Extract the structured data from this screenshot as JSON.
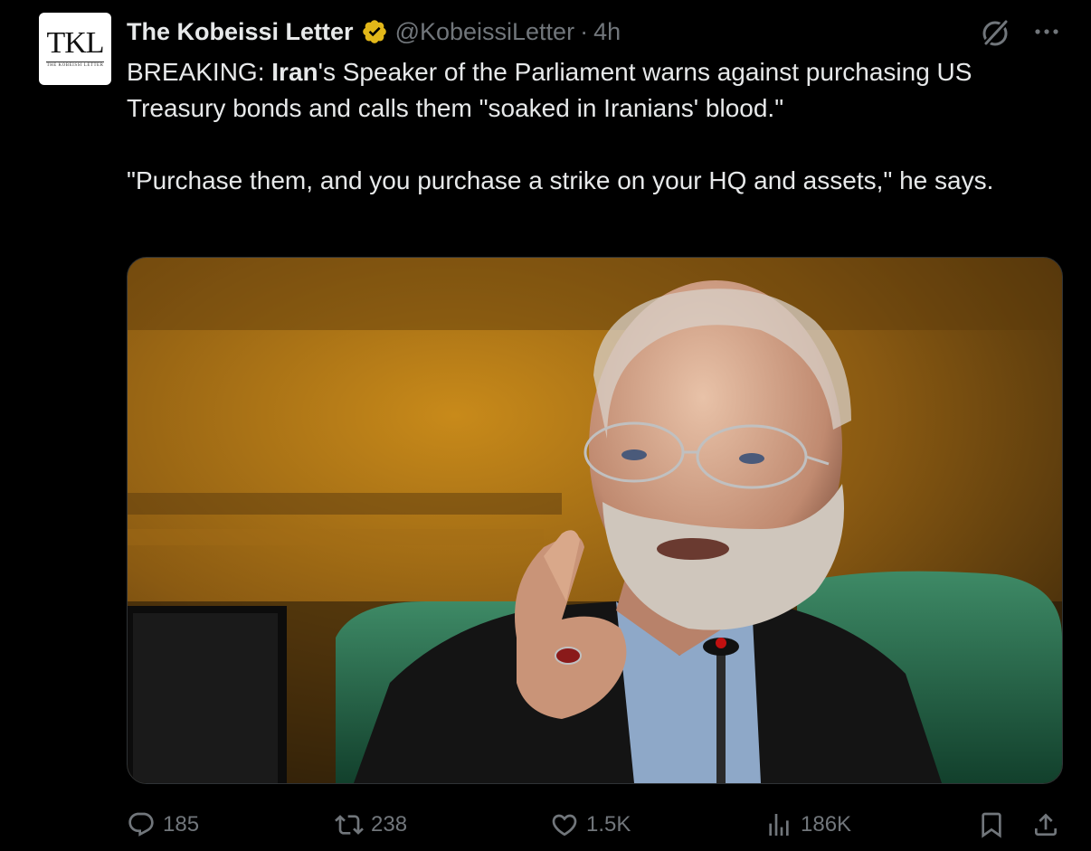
{
  "author": {
    "avatar_text": "TKL",
    "avatar_subtext": "THE KOBEISSI LETTER",
    "display_name": "The Kobeissi Letter",
    "handle": "@KobeissiLetter",
    "separator": "·",
    "time": "4h",
    "verified_icon": "verified-badge-icon",
    "verified_color": "#e2b719"
  },
  "header_icons": [
    "grok-icon",
    "more-icon"
  ],
  "tweet": {
    "p1_prefix": "BREAKING: ",
    "p1_bold": "Iran",
    "p1_rest": "'s Speaker of the Parliament warns against purchasing US Treasury bonds and calls them \"soaked in Iranians' blood.\"",
    "p2": "\"Purchase them, and you purchase a strike on your HQ and assets,\" he says."
  },
  "media": {
    "kind": "photo",
    "subject_icon": "photo-speaker-icon"
  },
  "actions": {
    "replies": "185",
    "reposts": "238",
    "likes": "1.5K",
    "views": "186K"
  },
  "colors": {
    "background": "#000000",
    "text": "#e7e9ea",
    "muted": "#71767b",
    "border": "#2f3336"
  }
}
